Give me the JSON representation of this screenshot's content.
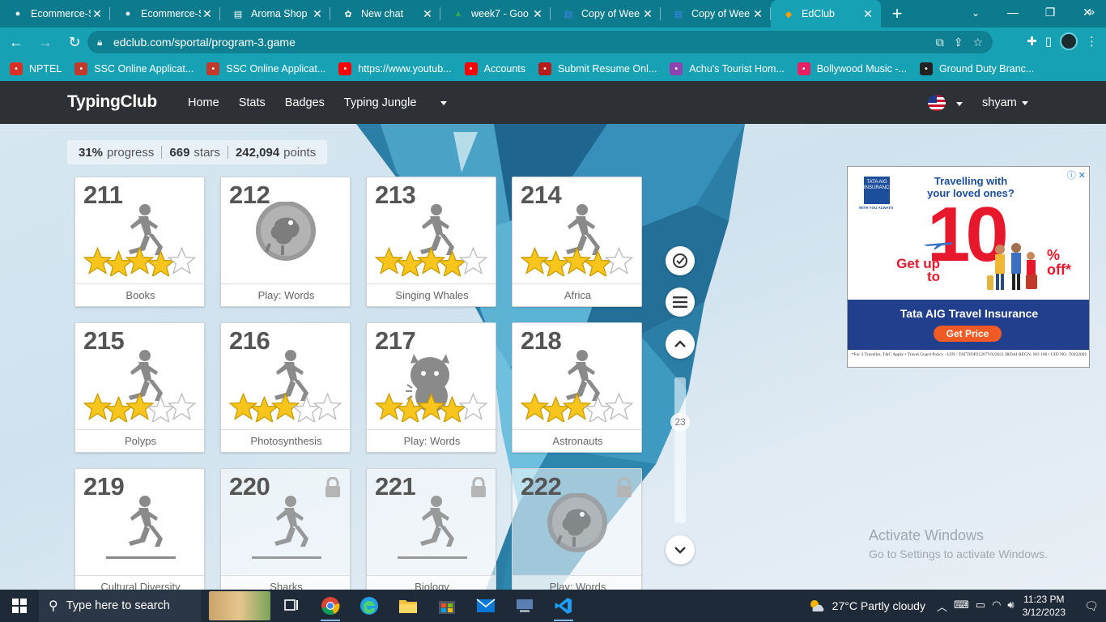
{
  "browser": {
    "tabs": [
      {
        "label": "Ecommerce-S",
        "icon": "github-icon"
      },
      {
        "label": "Ecommerce-S",
        "icon": "github-icon"
      },
      {
        "label": "Aroma Shop",
        "icon": "page-icon"
      },
      {
        "label": "New chat",
        "icon": "chatgpt-icon"
      },
      {
        "label": "week7 - Goo",
        "icon": "drive-icon"
      },
      {
        "label": "Copy of Wee",
        "icon": "docs-icon"
      },
      {
        "label": "Copy of Wee",
        "icon": "docs-icon"
      },
      {
        "label": "EdClub",
        "icon": "edclub-icon",
        "active": true
      }
    ],
    "url": "edclub.com/sportal/program-3.game",
    "bookmarks": [
      {
        "label": "NPTEL",
        "color": "#d93025"
      },
      {
        "label": "SSC Online Applicat...",
        "color": "#c0392b"
      },
      {
        "label": "SSC Online Applicat...",
        "color": "#c0392b"
      },
      {
        "label": "https://www.youtub...",
        "color": "#ff0000"
      },
      {
        "label": "Accounts",
        "color": "#ff0000"
      },
      {
        "label": "Submit Resume Onl...",
        "color": "#b71c1c"
      },
      {
        "label": "Achu's Tourist Hom...",
        "color": "#8e44ad"
      },
      {
        "label": "Bollywood Music -...",
        "color": "#e91e63"
      },
      {
        "label": "Ground Duty Branc...",
        "color": "#222"
      }
    ]
  },
  "site": {
    "logo": "TypingClub",
    "nav": [
      "Home",
      "Stats",
      "Badges",
      "Typing Jungle"
    ],
    "user": "shyam"
  },
  "stats": {
    "progress_value": "31%",
    "progress_label": "progress",
    "stars_value": "669",
    "stars_label": "stars",
    "points_value": "242,094",
    "points_label": "points"
  },
  "lessons": [
    {
      "num": "211",
      "label": "Books",
      "type": "runner",
      "stars": 4,
      "locked": false
    },
    {
      "num": "212",
      "label": "Play: Words",
      "type": "game",
      "stars": 0,
      "locked": false
    },
    {
      "num": "213",
      "label": "Singing Whales",
      "type": "runner",
      "stars": 4,
      "locked": false
    },
    {
      "num": "214",
      "label": "Africa",
      "type": "runner",
      "stars": 4,
      "locked": false
    },
    {
      "num": "215",
      "label": "Polyps",
      "type": "runner",
      "stars": 3,
      "locked": false
    },
    {
      "num": "216",
      "label": "Photosynthesis",
      "type": "runner",
      "stars": 3,
      "locked": false
    },
    {
      "num": "217",
      "label": "Play: Words",
      "type": "monster",
      "stars": 4,
      "locked": false
    },
    {
      "num": "218",
      "label": "Astronauts",
      "type": "runner",
      "stars": 3,
      "locked": false
    },
    {
      "num": "219",
      "label": "Cultural Diversity",
      "type": "runner-line",
      "stars": 0,
      "locked": false
    },
    {
      "num": "220",
      "label": "Sharks",
      "type": "runner-line",
      "stars": 0,
      "locked": true
    },
    {
      "num": "221",
      "label": "Biology",
      "type": "runner-line",
      "stars": 0,
      "locked": true
    },
    {
      "num": "222",
      "label": "Play: Words",
      "type": "game",
      "stars": 0,
      "locked": true
    }
  ],
  "side": {
    "scroll_value": "23"
  },
  "ad": {
    "headline": "Travelling with your loved ones?",
    "brand": "TATA AIG",
    "brand_sub": "INSURANCE",
    "brand_tag": "WITH YOU ALWAYS",
    "get_up_to": "Get up to",
    "big_number": "10",
    "percent": "% off*",
    "product": "Tata AIG Travel Insurance",
    "cta": "Get Price",
    "fine": "*For 3 Traveller, T&C Apply • Travel Guard Policy - UIN : TATTIOP21207V022021 IRDAI REGN. NO 108 • UID NO. T0422001"
  },
  "watermark": {
    "line1": "Activate Windows",
    "line2": "Go to Settings to activate Windows."
  },
  "taskbar": {
    "search_placeholder": "Type here to search",
    "weather": "27°C  Partly cloudy",
    "time": "11:23 PM",
    "date": "3/12/2023"
  }
}
